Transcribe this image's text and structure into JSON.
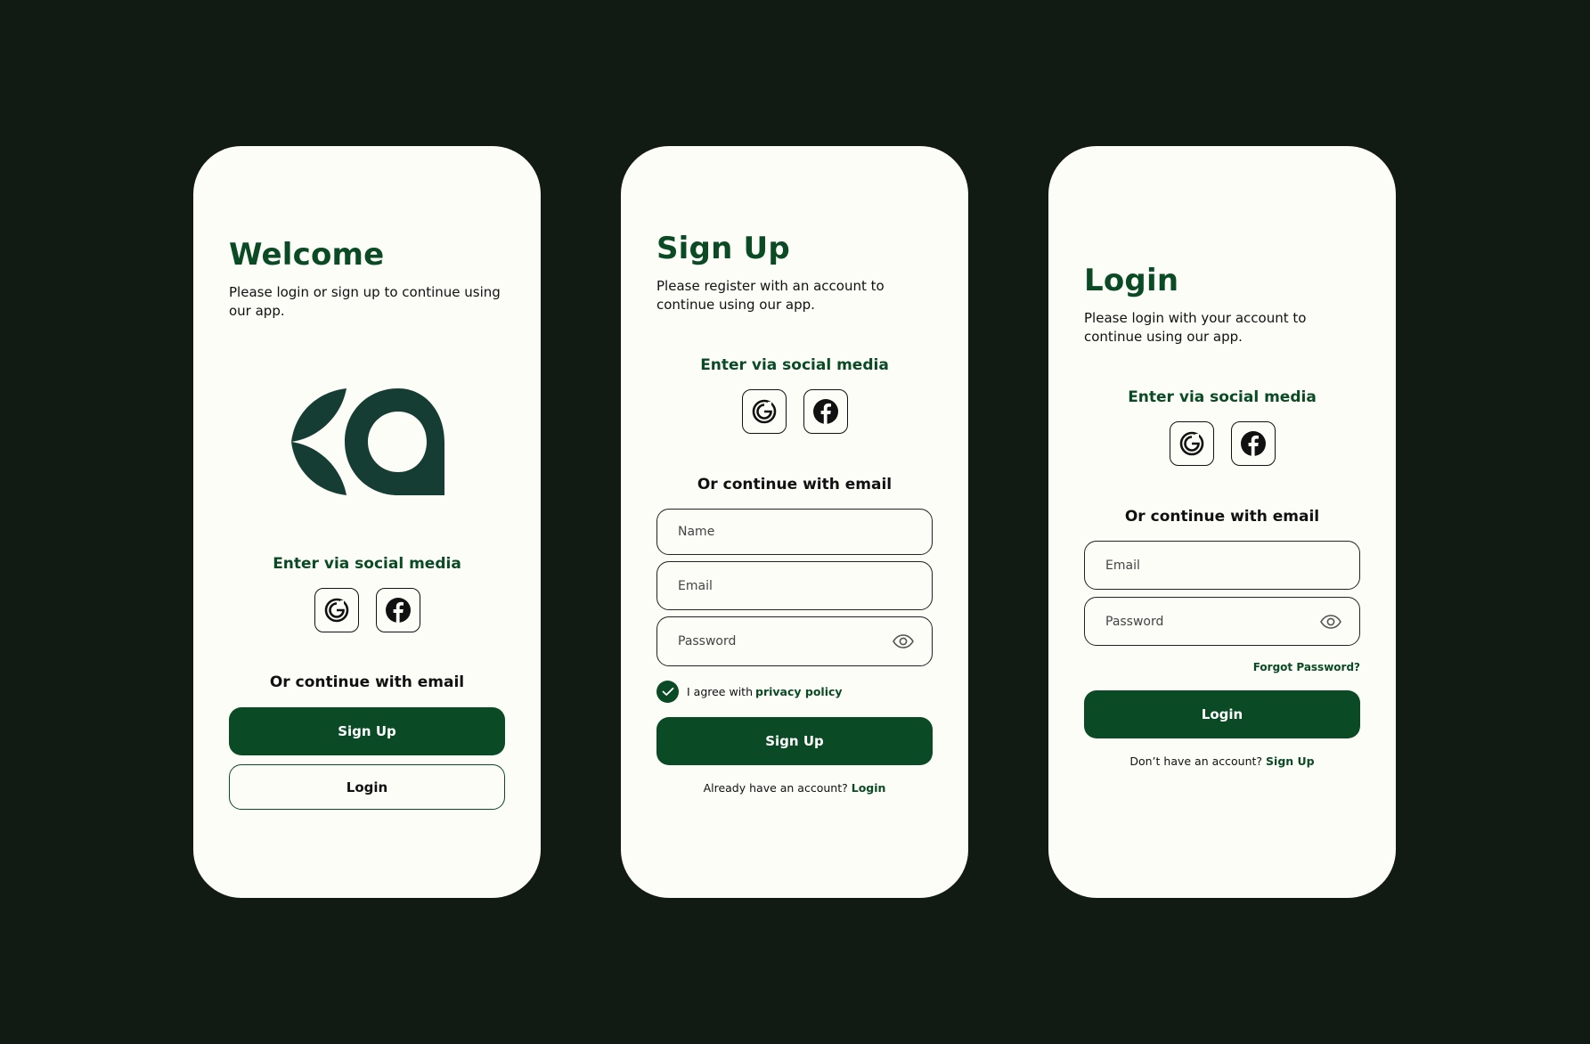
{
  "colors": {
    "background": "#111a13",
    "card": "#fcfdf6",
    "brand_green": "#0a4a25",
    "logo_green": "#163d33",
    "text": "#111111"
  },
  "welcome": {
    "title": "Welcome",
    "subtitle": "Please login or sign up to continue using our app.",
    "logo_icon": "app-logo-ka",
    "social_label": "Enter via social media",
    "social_icons": [
      "google-icon",
      "facebook-icon"
    ],
    "email_label": "Or continue with email",
    "signup_button": "Sign Up",
    "login_button": "Login"
  },
  "signup": {
    "title": "Sign Up",
    "subtitle": "Please register with an account to continue using our app.",
    "social_label": "Enter via social media",
    "social_icons": [
      "google-icon",
      "facebook-icon"
    ],
    "email_label": "Or continue with email",
    "name_placeholder": "Name",
    "email_placeholder": "Email",
    "password_placeholder": "Password",
    "password_icon": "eye-icon",
    "agree_checked": true,
    "agree_text": "I agree with",
    "privacy_link": "privacy policy",
    "signup_button": "Sign Up",
    "have_account_text": "Already have an account?",
    "login_link": "Login"
  },
  "login": {
    "title": "Login",
    "subtitle": "Please login with your account to continue using our app.",
    "social_label": "Enter via social media",
    "social_icons": [
      "google-icon",
      "facebook-icon"
    ],
    "email_label": "Or continue with email",
    "email_placeholder": "Email",
    "password_placeholder": "Password",
    "password_icon": "eye-icon",
    "forgot_link": "Forgot Password?",
    "login_button": "Login",
    "no_account_text": "Don’t have an account?",
    "signup_link": "Sign Up"
  }
}
